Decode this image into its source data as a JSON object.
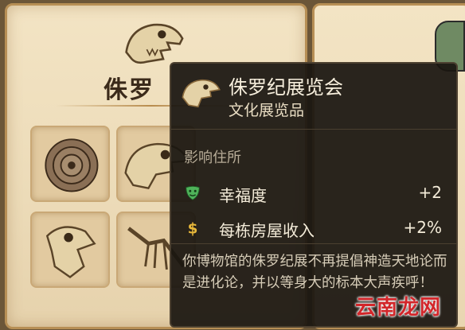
{
  "background_card": {
    "title": "侏罗"
  },
  "tooltip": {
    "name": "侏罗纪展览会",
    "type": "文化展览品",
    "section_title": "影响住所",
    "effects": [
      {
        "icon": "theater-mask-icon",
        "label": "幸福度",
        "value": "+2",
        "color": "#4fb35a"
      },
      {
        "icon": "dollar-sign-icon",
        "label": "每栋房屋收入",
        "value": "+2%",
        "color": "#e8b83a"
      }
    ],
    "description": "你博物馆的侏罗纪展不再提倡神造天地论而是进化论，并以等身大的标本大声疾呼！"
  },
  "watermark": "云南龙网",
  "colors": {
    "card_bg": "#f0e0bf",
    "card_border": "#b78f55",
    "tooltip_bg": "#1a1510",
    "happiness_icon": "#4fb35a",
    "income_icon": "#e8b83a"
  }
}
